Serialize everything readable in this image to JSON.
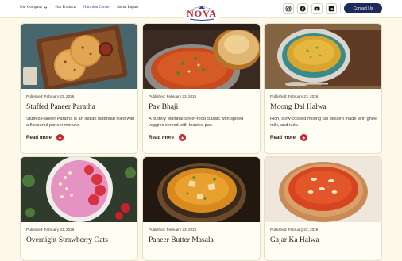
{
  "nav": {
    "items": [
      {
        "label": "Our Company",
        "has_dropdown": true
      },
      {
        "label": "Our Products",
        "has_dropdown": false
      },
      {
        "label": "Nutrition Center",
        "has_dropdown": false,
        "active": true
      },
      {
        "label": "Social Impact",
        "has_dropdown": false
      }
    ]
  },
  "logo": {
    "text": "NOVA",
    "tagline": "Naturally Nourished Since 1950"
  },
  "social": [
    "instagram-icon",
    "facebook-icon",
    "youtube-icon",
    "linkedin-icon"
  ],
  "contact_label": "Contact Us",
  "colors": {
    "accent": "#c2262e",
    "navy": "#1e2a5c",
    "background": "#fdf9ea"
  },
  "cards": [
    {
      "published": "Published: February 23, 2026",
      "title": "Stuffed Paneer Paratha",
      "desc": "Stuffed Paneer Paratha is an Indian flatbread filled with a flavourful paneer mixture.",
      "read_more": "Read more"
    },
    {
      "published": "Published: February 23, 2026",
      "title": "Pav Bhaji",
      "desc": "A buttery Mumbai street-food classic with spiced veggies served with toasted pav.",
      "read_more": "Read more"
    },
    {
      "published": "Published: February 23, 2026",
      "title": "Moong Dal Halwa",
      "desc": "Rich, slow-cooked moong dal dessert made with ghee, milk, and nuts.",
      "read_more": "Read more"
    },
    {
      "published": "Published: February 23, 2026",
      "title": "Overnight Strawberry Oats"
    },
    {
      "published": "Published: February 23, 2026",
      "title": "Paneer Butter Masala"
    },
    {
      "published": "Published: February 23, 2026",
      "title": "Gajar Ka Halwa"
    }
  ]
}
